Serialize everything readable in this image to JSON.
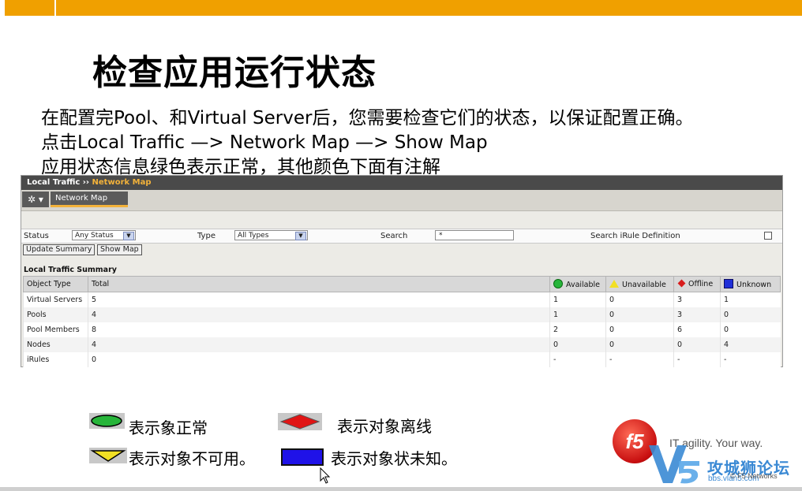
{
  "slide": {
    "title": "检查应用运行状态",
    "line1": "在配置完Pool、和Virtual Server后，您需要检查它们的状态，以保证配置正确。",
    "line2": "点击Local Traffic   —> Network Map   —>  Show Map",
    "line3": "应用状态信息绿色表示正常，其他颜色下面有注解"
  },
  "panel": {
    "breadcrumb": {
      "root": "Local Traffic",
      "separator": "››",
      "current": "Network Map"
    },
    "gear_label": "✲ ▾",
    "tab_label": "Network Map",
    "filters": {
      "status_label": "Status",
      "status_value": "Any Status",
      "type_label": "Type",
      "type_value": "All Types",
      "search_label": "Search",
      "search_value": "*",
      "irule_label": "Search iRule Definition"
    },
    "buttons": {
      "update": "Update Summary",
      "show_map": "Show Map"
    },
    "section_title": "Local Traffic Summary",
    "columns": {
      "object_type": "Object Type",
      "total": "Total",
      "available": "Available",
      "unavailable": "Unavailable",
      "offline": "Offline",
      "unknown": "Unknown"
    },
    "rows": [
      {
        "type": "Virtual Servers",
        "total": "5",
        "available": "1",
        "unavailable": "0",
        "offline": "3",
        "unknown": "1"
      },
      {
        "type": "Pools",
        "total": "4",
        "available": "1",
        "unavailable": "0",
        "offline": "3",
        "unknown": "0"
      },
      {
        "type": "Pool Members",
        "total": "8",
        "available": "2",
        "unavailable": "0",
        "offline": "6",
        "unknown": "0"
      },
      {
        "type": "Nodes",
        "total": "4",
        "available": "0",
        "unavailable": "0",
        "offline": "0",
        "unknown": "4"
      },
      {
        "type": "iRules",
        "total": "0",
        "available": "-",
        "unavailable": "-",
        "offline": "-",
        "unknown": "-"
      }
    ]
  },
  "legend": {
    "available": "表示象正常",
    "offline": "表示对象离线",
    "unavailable": "表示对象不可用。",
    "unknown": "表示对象状未知。"
  },
  "branding": {
    "f5_logo_text": "f5",
    "tagline": "IT agility. Your way.",
    "copyright": "© F5 Networks",
    "watermark_title": "攻城狮论坛",
    "watermark_url": "bbs.vlan5.com"
  },
  "colors": {
    "top_bar": "#f0a000",
    "available": "#27b53a",
    "unavailable": "#f2e024",
    "offline": "#d81c1c",
    "unknown": "#1f2fd8",
    "link": "#2e57b8"
  }
}
